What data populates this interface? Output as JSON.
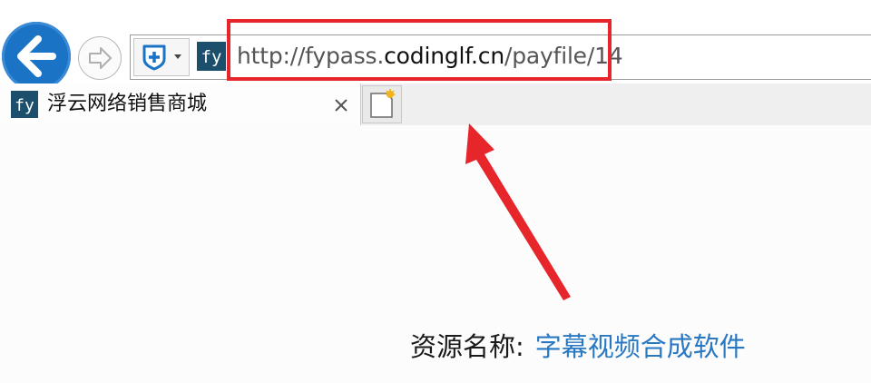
{
  "browser": {
    "favicon_text": "fy",
    "address": {
      "url_prefix": "http://fypass.",
      "url_domain": "codinglf.cn",
      "url_path": "/payfile/14"
    },
    "tab": {
      "favicon_text": "fy",
      "title": "浮云网络销售商城",
      "close_glyph": "×"
    }
  },
  "annotation": {
    "label": "资源名称:",
    "value": "字幕视频合成软件"
  },
  "colors": {
    "back_button": "#1a73c5",
    "highlight_box": "#e6262b",
    "arrow": "#e6262b",
    "caption_value": "#2878c2",
    "favicon_bg": "#1c4f6b"
  }
}
